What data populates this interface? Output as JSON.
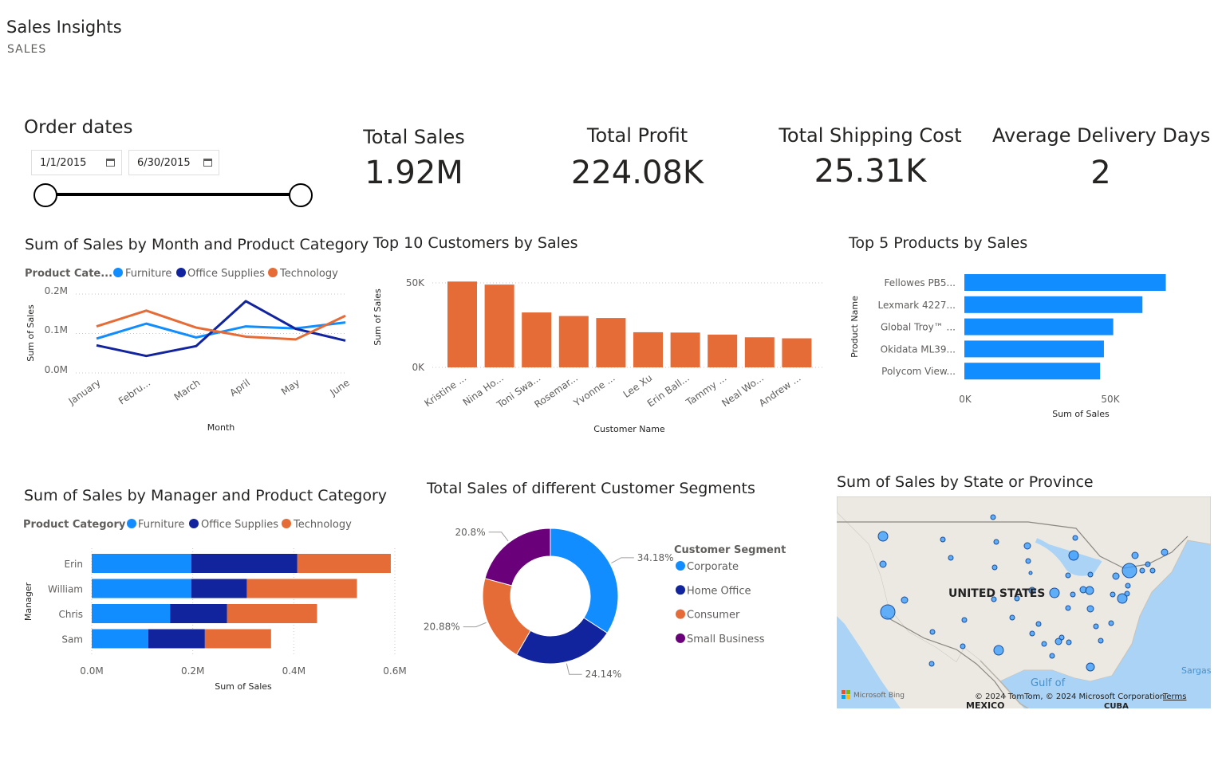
{
  "header": {
    "title": "Sales Insights",
    "subtitle": "SALES"
  },
  "slicer": {
    "title": "Order dates",
    "start": "1/1/2015",
    "end": "6/30/2015"
  },
  "kpis": [
    {
      "label": "Total Sales",
      "value": "1.92M"
    },
    {
      "label": "Total Profit",
      "value": "224.08K"
    },
    {
      "label": "Total Shipping Cost",
      "value": "25.31K"
    },
    {
      "label": "Average Delivery Days",
      "value": "2"
    }
  ],
  "colors": {
    "furniture": "#118dff",
    "office_supplies": "#12239e",
    "technology": "#e66c37",
    "small_business": "#6b007b"
  },
  "charts": {
    "line": {
      "title": "Sum of Sales by Month and Product Category",
      "legend_title": "Product Cate...",
      "legend": [
        "Furniture",
        "Office Supplies",
        "Technology"
      ],
      "xlabel": "Month",
      "ylabel": "Sum of Sales",
      "y_ticks": [
        "0.0M",
        "0.1M",
        "0.2M"
      ]
    },
    "customers": {
      "title": "Top 10 Customers by Sales",
      "xlabel": "Customer Name",
      "ylabel": "Sum of Sales",
      "y_ticks": [
        "0K",
        "50K"
      ]
    },
    "products": {
      "title": "Top 5 Products by Sales",
      "xlabel": "Sum of Sales",
      "ylabel": "Product Name",
      "x_ticks": [
        "0K",
        "50K"
      ]
    },
    "manager": {
      "title": "Sum of Sales by Manager and Product Category",
      "legend_title": "Product Category",
      "legend": [
        "Furniture",
        "Office Supplies",
        "Technology"
      ],
      "xlabel": "Sum of Sales",
      "ylabel": "Manager",
      "x_ticks": [
        "0.0M",
        "0.2M",
        "0.4M",
        "0.6M"
      ]
    },
    "donut": {
      "title": "Total Sales of different Customer Segments",
      "legend_title": "Customer Segment"
    },
    "map": {
      "title": "Sum of Sales by State or Province",
      "country_label": "UNITED STATES",
      "gulf_label": "Gulf of",
      "mexico_label": "MEXICO",
      "sargasso_label": "Sargas",
      "cuba_label": "CUBA",
      "bing": "Microsoft Bing",
      "copyright": "© 2024 TomTom, © 2024 Microsoft Corporation",
      "terms": "Terms"
    }
  },
  "chart_data": [
    {
      "type": "line",
      "title": "Sum of Sales by Month and Product Category",
      "categories": [
        "January",
        "Febru...",
        "March",
        "April",
        "May",
        "June"
      ],
      "series": [
        {
          "name": "Furniture",
          "values": [
            0.087,
            0.125,
            0.09,
            0.118,
            0.113,
            0.128
          ]
        },
        {
          "name": "Office Supplies",
          "values": [
            0.07,
            0.043,
            0.068,
            0.182,
            0.112,
            0.082
          ]
        },
        {
          "name": "Technology",
          "values": [
            0.118,
            0.158,
            0.115,
            0.092,
            0.085,
            0.145
          ]
        }
      ],
      "xlabel": "Month",
      "ylabel": "Sum of Sales",
      "ylim": [
        0,
        0.2
      ]
    },
    {
      "type": "bar",
      "title": "Top 10 Customers by Sales",
      "categories": [
        "Kristine ...",
        "Nina Ho...",
        "Toni Swa...",
        "Rosemar...",
        "Yvonne ...",
        "Lee Xu",
        "Erin Ball...",
        "Tammy ...",
        "Neal Wo...",
        "Andrew ..."
      ],
      "values": [
        50800,
        49000,
        32500,
        30400,
        29200,
        20800,
        20600,
        19400,
        17800,
        17200
      ],
      "xlabel": "Customer Name",
      "ylabel": "Sum of Sales",
      "ylim": [
        0,
        50000
      ]
    },
    {
      "type": "bar",
      "orientation": "horizontal",
      "title": "Top 5 Products by Sales",
      "categories": [
        "Fellowes PB5...",
        "Lexmark 4227...",
        "Global Troy™ ...",
        "Okidata ML39...",
        "Polycom View..."
      ],
      "values": [
        69000,
        61000,
        51000,
        47800,
        46500
      ],
      "xlabel": "Sum of Sales",
      "ylabel": "Product Name",
      "xlim": [
        0,
        50000
      ]
    },
    {
      "type": "bar",
      "orientation": "horizontal",
      "stacked": true,
      "title": "Sum of Sales by Manager and Product Category",
      "categories": [
        "Erin",
        "William",
        "Chris",
        "Sam"
      ],
      "series": [
        {
          "name": "Furniture",
          "values": [
            0.197,
            0.197,
            0.155,
            0.112
          ]
        },
        {
          "name": "Office Supplies",
          "values": [
            0.21,
            0.11,
            0.113,
            0.112
          ]
        },
        {
          "name": "Technology",
          "values": [
            0.185,
            0.218,
            0.178,
            0.131
          ]
        }
      ],
      "xlabel": "Sum of Sales",
      "ylabel": "Manager",
      "xlim": [
        0,
        0.6
      ]
    },
    {
      "type": "pie",
      "donut": true,
      "title": "Total Sales of different Customer Segments",
      "labels": [
        "Corporate",
        "Home Office",
        "Consumer",
        "Small Business"
      ],
      "values": [
        34.18,
        24.14,
        20.88,
        20.8
      ],
      "value_labels": [
        "34.18%",
        "24.14%",
        "20.88%",
        "20.8%"
      ],
      "legend_title": "Customer Segment"
    }
  ]
}
